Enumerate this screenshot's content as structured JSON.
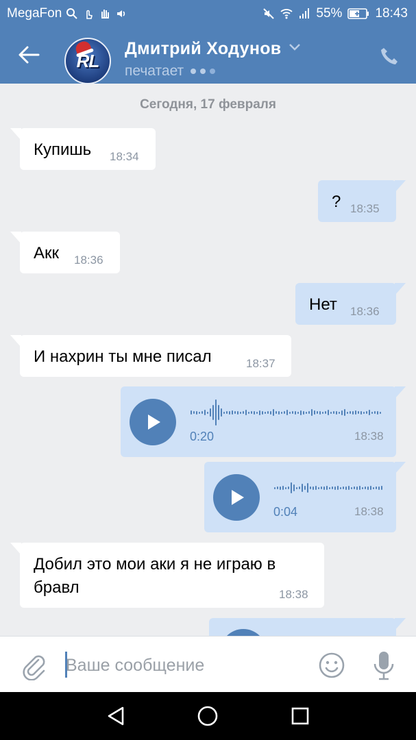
{
  "status_bar": {
    "carrier": "MegaFon",
    "battery": "55%",
    "time": "18:43"
  },
  "header": {
    "contact_name": "Дмитрий Ходунов",
    "status": "печатает",
    "avatar_text": "RL"
  },
  "date_separator": "Сегодня, 17 февраля",
  "messages": [
    {
      "dir": "in",
      "text": "Купишь",
      "time": "18:34"
    },
    {
      "dir": "out",
      "text": "?",
      "time": "18:35"
    },
    {
      "dir": "in",
      "text": "Акк",
      "time": "18:36"
    },
    {
      "dir": "out",
      "text": "Нет",
      "time": "18:36"
    },
    {
      "dir": "in",
      "text": "И нахрин ты мне писал",
      "time": "18:37"
    },
    {
      "dir": "out",
      "type": "voice",
      "duration": "0:20",
      "time": "18:38"
    },
    {
      "dir": "out",
      "type": "voice",
      "duration": "0:04",
      "time": "18:38"
    },
    {
      "dir": "in",
      "text": "Добил это мои аки я не играю в",
      "text2": "бравл",
      "time": "18:38"
    }
  ],
  "composer": {
    "placeholder": "Ваше сообщение"
  },
  "icons": {
    "back": "arrow-left-icon",
    "phone": "phone-icon",
    "attach": "paperclip-icon",
    "emoji": "smiley-icon",
    "mic": "microphone-icon",
    "nav_back": "triangle-back-icon",
    "nav_home": "circle-home-icon",
    "nav_recent": "square-recent-icon"
  },
  "colors": {
    "accent": "#5181b8",
    "bubble_out": "#cfe1f7",
    "bubble_in": "#ffffff",
    "background": "#edeef0"
  }
}
